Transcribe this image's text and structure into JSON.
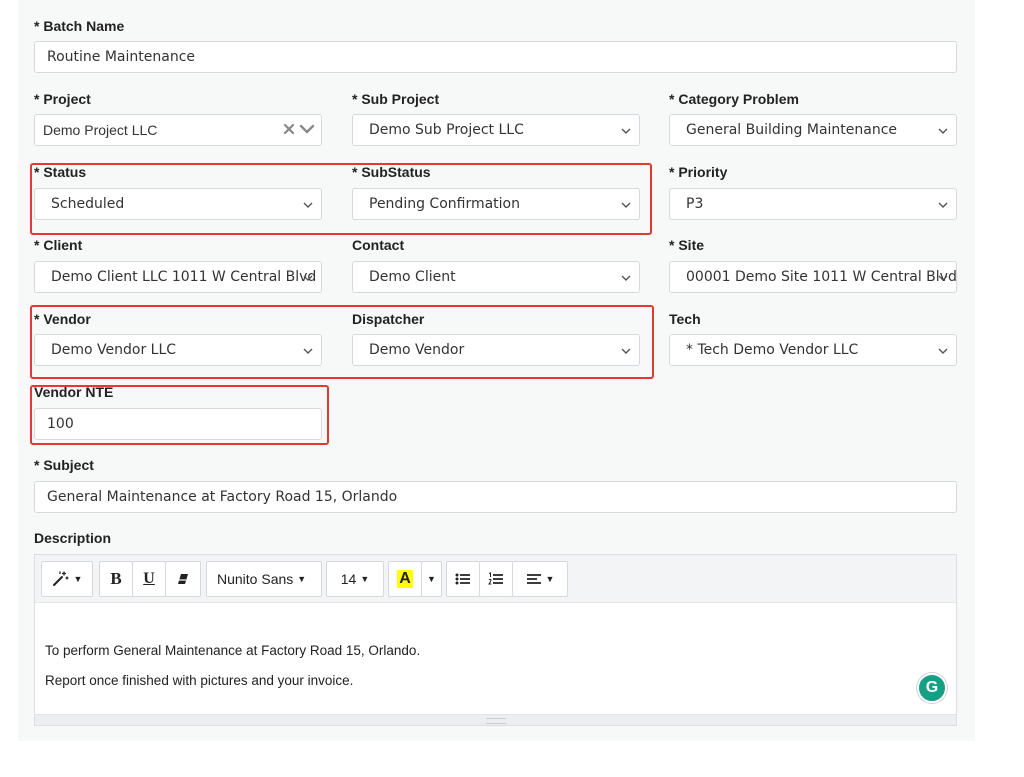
{
  "form": {
    "batch_name": {
      "label": "* Batch Name",
      "value": "Routine Maintenance"
    },
    "project": {
      "label": "* Project",
      "value": "Demo Project LLC"
    },
    "sub_project": {
      "label": "* Sub Project",
      "value": "Demo Sub Project LLC"
    },
    "category_problem": {
      "label": "* Category Problem",
      "value": "General Building Maintenance"
    },
    "status": {
      "label": "* Status",
      "value": "Scheduled"
    },
    "substatus": {
      "label": "* SubStatus",
      "value": "Pending Confirmation"
    },
    "priority": {
      "label": "* Priority",
      "value": "P3"
    },
    "client": {
      "label": "* Client",
      "value": "Demo Client LLC 1011 W Central Blvd"
    },
    "contact": {
      "label": "Contact",
      "value": "Demo Client"
    },
    "site": {
      "label": "* Site",
      "value": "00001 Demo Site 1011 W Central Blvd"
    },
    "vendor": {
      "label": "* Vendor",
      "value": "Demo Vendor LLC"
    },
    "dispatcher": {
      "label": "Dispatcher",
      "value": "Demo Vendor"
    },
    "tech": {
      "label": "Tech",
      "value": "* Tech Demo Vendor LLC"
    },
    "vendor_nte": {
      "label": "Vendor NTE",
      "value": "100"
    },
    "subject": {
      "label": "* Subject",
      "value": "General Maintenance at Factory Road 15, Orlando"
    },
    "description": {
      "label": "Description"
    }
  },
  "editor": {
    "font_name": "Nunito Sans",
    "font_size": "14",
    "bold": "B",
    "underline": "U",
    "color_letter": "A",
    "lines": [
      "To perform General Maintenance at Factory Road 15, Orlando.",
      "Report once finished with pictures and your invoice."
    ]
  },
  "grammarly": {
    "letter": "G"
  },
  "colors": {
    "highlight_red": "#e23b2e",
    "grammarly_green": "#15a085",
    "text_highlight": "#ffff00"
  }
}
